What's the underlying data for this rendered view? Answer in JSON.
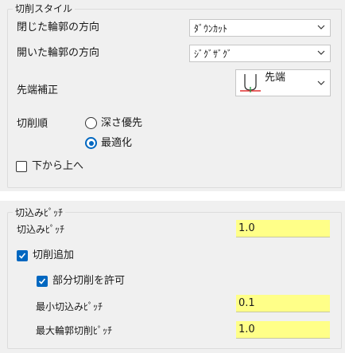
{
  "cutting_style": {
    "group_title": "切削スタイル",
    "closed_contour_label": "閉じた輪郭の方向",
    "closed_contour_value": "ﾀﾞｳﾝｶｯﾄ",
    "open_contour_label": "開いた輪郭の方向",
    "open_contour_value": "ｼﾞｸﾞｻﾞｸﾞ",
    "tip_comp_label": "先端補正",
    "tip_comp_value": "先端",
    "order_label": "切削順",
    "order_options": [
      {
        "label": "深さ優先",
        "selected": false
      },
      {
        "label": "最適化",
        "selected": true
      }
    ],
    "bottom_up_label": "下から上へ",
    "bottom_up_checked": false
  },
  "stepover": {
    "group_title": "切込みﾋﾟｯﾁ",
    "stepover_label": "切込みﾋﾟｯﾁ",
    "stepover_value": "1.0",
    "additional_passes_label": "切削追加",
    "additional_passes_checked": true,
    "allow_partial_label": "部分切削を許可",
    "allow_partial_checked": true,
    "min_stepover_label": "最小切込みﾋﾟｯﾁ",
    "min_stepover_value": "0.1",
    "max_contour_stepover_label": "最大輪郭切削ﾋﾟｯﾁ",
    "max_contour_stepover_value": "1.0"
  },
  "colors": {
    "accent": "#0067c0",
    "field_bg": "#ffff88",
    "panel_bg": "#f0f0f0"
  }
}
